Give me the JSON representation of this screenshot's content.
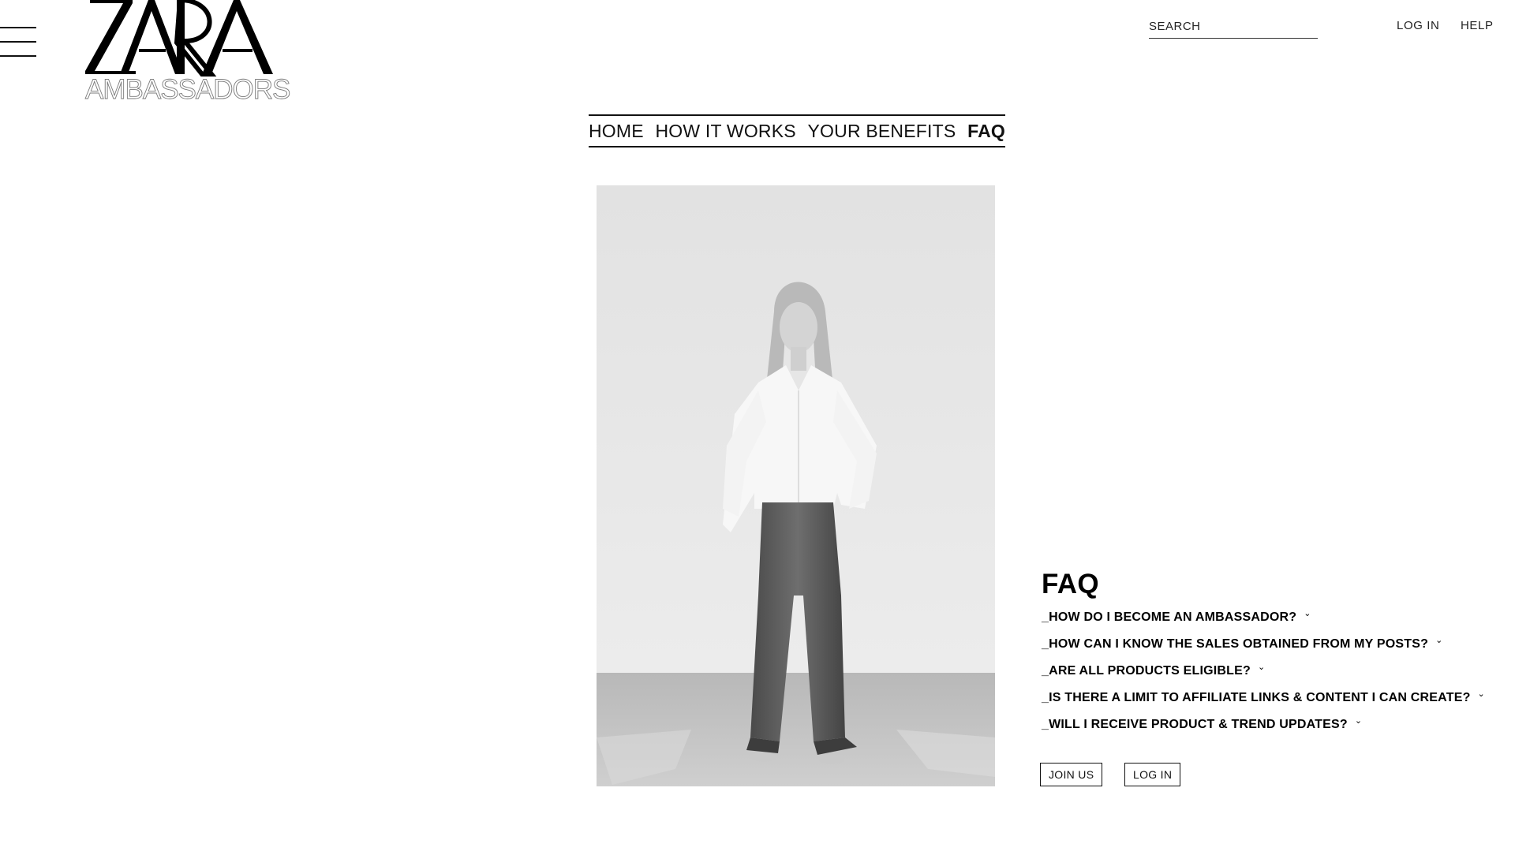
{
  "header": {
    "menu_icon": "hamburger-menu-icon",
    "logo": {
      "brand": "ZARA",
      "subtitle": "AMBASSADORS"
    },
    "search": {
      "placeholder": "SEARCH",
      "value": ""
    },
    "login_label": "LOG IN",
    "help_label": "HELP"
  },
  "nav": {
    "tabs": [
      {
        "label": "HOME",
        "active": false
      },
      {
        "label": "HOW IT WORKS",
        "active": false
      },
      {
        "label": "YOUR BENEFITS",
        "active": false
      },
      {
        "label": "FAQ",
        "active": true
      }
    ]
  },
  "faq": {
    "title": "FAQ",
    "chevron_icon": "chevron-down-icon",
    "questions": [
      "_HOW DO I BECOME AN AMBASSADOR?",
      "_HOW CAN I KNOW THE SALES OBTAINED FROM MY POSTS?",
      "_ARE ALL PRODUCTS ELIGIBLE?",
      "_IS THERE A LIMIT TO AFFILIATE LINKS & CONTENT I CAN CREATE?",
      "_WILL I RECEIVE PRODUCT & TREND UPDATES?"
    ],
    "join_label": "JOIN US",
    "login_label": "LOG IN"
  },
  "colors": {
    "text": "#000000",
    "background": "#ffffff",
    "logo_subtitle_outline": "#7a7a7a"
  }
}
